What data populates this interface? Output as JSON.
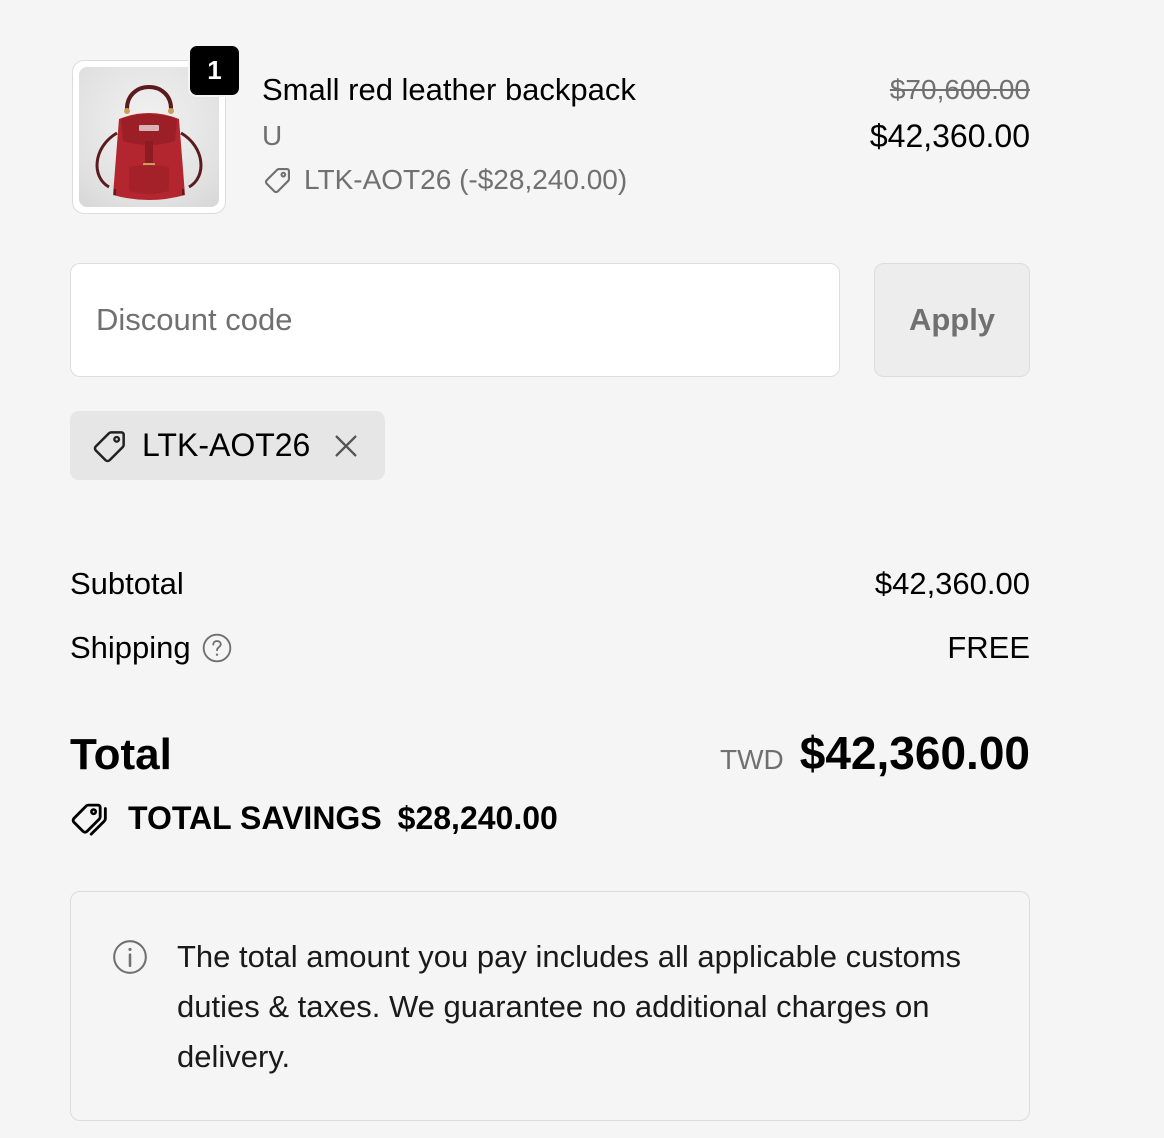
{
  "line_item": {
    "title": "Small red leather backpack",
    "variant": "U",
    "quantity": "1",
    "discount_line": "LTK-AOT26 (-$28,240.00)",
    "original_price": "$70,600.00",
    "price": "$42,360.00",
    "image_icon": "red-backpack-image"
  },
  "discount_form": {
    "placeholder": "Discount code",
    "apply_label": "Apply",
    "applied_code": "LTK-AOT26"
  },
  "totals": {
    "subtotal_label": "Subtotal",
    "subtotal_value": "$42,360.00",
    "shipping_label": "Shipping",
    "shipping_value": "FREE",
    "total_label": "Total",
    "currency": "TWD",
    "total_value": "$42,360.00",
    "savings_label": "TOTAL SAVINGS",
    "savings_value": "$28,240.00"
  },
  "info": {
    "text": "The total amount you pay includes all applicable customs duties & taxes. We guarantee no additional charges on delivery."
  },
  "colors": {
    "background": "#f5f5f5",
    "muted_text": "#707070",
    "badge": "#000000",
    "product_red": "#b3262f"
  }
}
